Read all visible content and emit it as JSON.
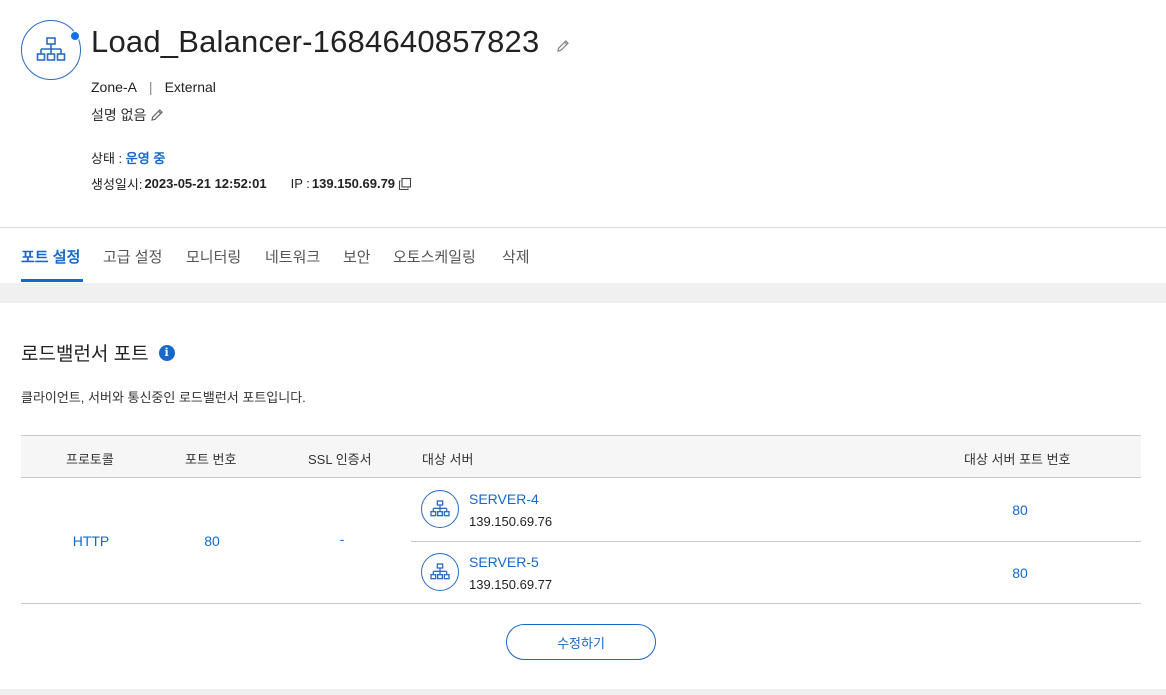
{
  "header": {
    "title": "Load_Balancer-1684640857823",
    "zone": "Zone-A",
    "separator": "|",
    "type": "External",
    "description": "설명 없음",
    "status_label": "상태 :",
    "status_value": "운영 중",
    "created_label": "생성일시:",
    "created_value": "2023-05-21 12:52:01",
    "ip_label": "IP :",
    "ip_value": "139.150.69.79"
  },
  "tabs": [
    {
      "label": "포트 설정",
      "active": true
    },
    {
      "label": "고급 설정",
      "active": false
    },
    {
      "label": "모니터링",
      "active": false
    },
    {
      "label": "네트워크",
      "active": false
    },
    {
      "label": "보안",
      "active": false
    },
    {
      "label": "오토스케일링",
      "active": false
    },
    {
      "label": "삭제",
      "active": false
    }
  ],
  "section": {
    "title": "로드밸런서 포트",
    "info_glyph": "i",
    "description": "클라이언트, 서버와 통신중인 로드밸런서 포트입니다."
  },
  "table": {
    "headers": [
      "프로토콜",
      "포트 번호",
      "SSL 인증서",
      "대상 서버",
      "대상 서버 포트 번호"
    ],
    "rows": [
      {
        "protocol": "HTTP",
        "port": "80",
        "ssl": "-",
        "servers": [
          {
            "name": "SERVER-4",
            "ip": "139.150.69.76",
            "port": "80"
          },
          {
            "name": "SERVER-5",
            "ip": "139.150.69.77",
            "port": "80"
          }
        ]
      }
    ]
  },
  "actions": {
    "edit_label": "수정하기"
  },
  "icons": {
    "lb": "network-tree-icon",
    "edit": "pencil-icon",
    "copy": "copy-icon",
    "info": "info-icon"
  },
  "colors": {
    "accent": "#1768c9",
    "border": "#c8c8c8",
    "band": "#f0f0f0"
  }
}
